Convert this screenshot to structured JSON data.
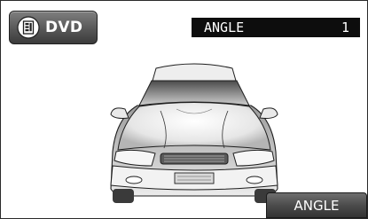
{
  "source_button": {
    "label": "DVD",
    "icon": "disc-changer-icon"
  },
  "angle_indicator": {
    "label": "ANGLE",
    "value": "1"
  },
  "angle_button": {
    "label": "ANGLE"
  },
  "illustration": {
    "icon": "car-front-illustration"
  }
}
